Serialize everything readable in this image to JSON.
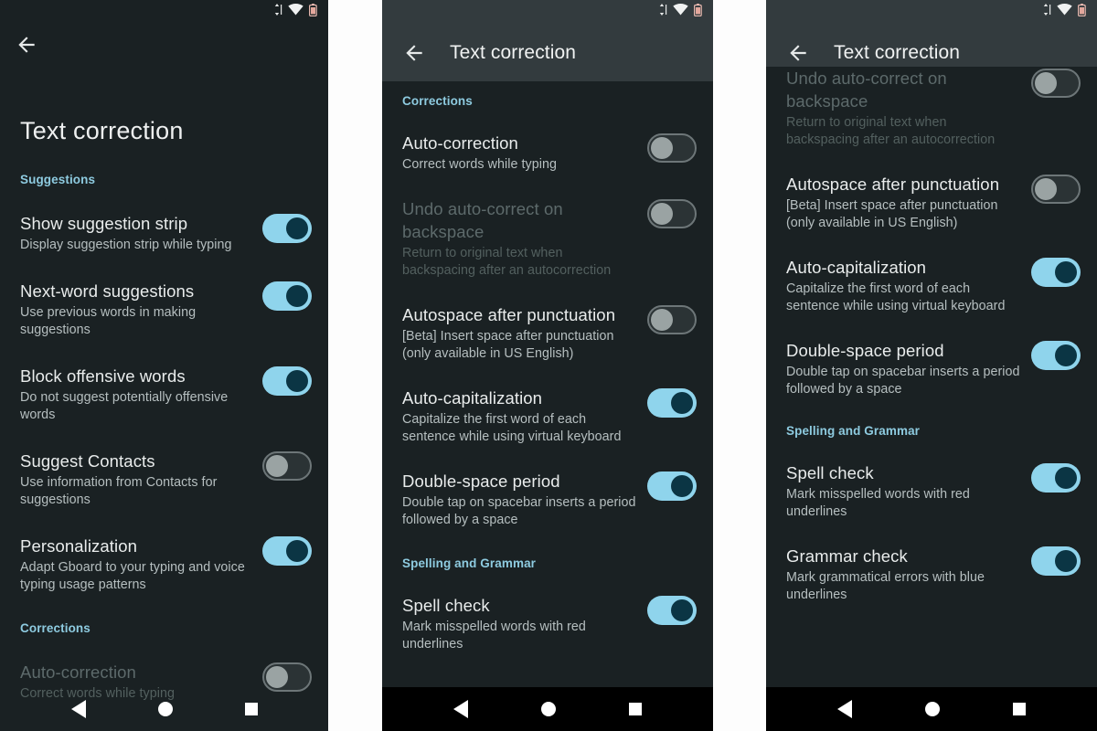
{
  "colors": {
    "background": "#1a2123",
    "appbar": "#333b3e",
    "section_header": "#8ecbe0",
    "toggle_on_track": "#8fd4ec",
    "toggle_on_knob": "#0b3544",
    "toggle_off_track": "#2b3335",
    "toggle_off_knob": "#9aa3a3",
    "title_text": "#e9ecec",
    "sub_text": "#b6bfc0",
    "disabled_text": "#5d6a6b",
    "navbar": "#000000"
  },
  "statusbar": {
    "icons": [
      "data-transfer-arrows-icon",
      "wifi-icon",
      "battery-icon"
    ]
  },
  "navbar": {
    "back_label": "back-triangle",
    "home_label": "home-circle",
    "recents_label": "recents-square"
  },
  "panel1": {
    "back_icon": "back-arrow-icon",
    "page_title": "Text correction",
    "sections": [
      {
        "header": "Suggestions",
        "items": [
          {
            "title": "Show suggestion strip",
            "subtitle": "Display suggestion strip while typing",
            "toggle": "on",
            "disabled": false
          },
          {
            "title": "Next-word suggestions",
            "subtitle": "Use previous words in making suggestions",
            "toggle": "on",
            "disabled": false
          },
          {
            "title": "Block offensive words",
            "subtitle": "Do not suggest potentially offensive words",
            "toggle": "on",
            "disabled": false
          },
          {
            "title": "Suggest Contacts",
            "subtitle": "Use information from Contacts for suggestions",
            "toggle": "off",
            "disabled": false
          },
          {
            "title": "Personalization",
            "subtitle": "Adapt Gboard to your typing and voice typing usage patterns",
            "toggle": "on",
            "disabled": false
          }
        ]
      },
      {
        "header": "Corrections",
        "items": [
          {
            "title": "Auto-correction",
            "subtitle": "Correct words while typing",
            "toggle": "off",
            "disabled": true
          }
        ]
      }
    ]
  },
  "panel2": {
    "back_icon": "back-arrow-icon",
    "appbar_title": "Text correction",
    "sections": [
      {
        "header": "Corrections",
        "items": [
          {
            "title": "Auto-correction",
            "subtitle": "Correct words while typing",
            "toggle": "off",
            "disabled": false
          },
          {
            "title": "Undo auto-correct on backspace",
            "subtitle": "Return to original text when backspacing after an autocorrection",
            "toggle": "off",
            "disabled": true
          },
          {
            "title": "Autospace after punctuation",
            "subtitle": "[Beta] Insert space after punctuation (only available in US English)",
            "toggle": "off",
            "disabled": false
          },
          {
            "title": "Auto-capitalization",
            "subtitle": "Capitalize the first word of each sentence while using virtual keyboard",
            "toggle": "on",
            "disabled": false
          },
          {
            "title": "Double-space period",
            "subtitle": "Double tap on spacebar inserts a period followed by a space",
            "toggle": "on",
            "disabled": false
          }
        ]
      },
      {
        "header": "Spelling and Grammar",
        "items": [
          {
            "title": "Spell check",
            "subtitle": "Mark misspelled words with red underlines",
            "toggle": "on",
            "disabled": false
          }
        ]
      }
    ]
  },
  "panel3": {
    "back_icon": "back-arrow-icon",
    "appbar_title": "Text correction",
    "sections": [
      {
        "header": "",
        "items": [
          {
            "title": "Undo auto-correct on backspace",
            "subtitle": "Return to original text when backspacing after an autocorrection",
            "toggle": "off",
            "disabled": true
          },
          {
            "title": "Autospace after punctuation",
            "subtitle": "[Beta] Insert space after punctuation (only available in US English)",
            "toggle": "off",
            "disabled": false
          },
          {
            "title": "Auto-capitalization",
            "subtitle": "Capitalize the first word of each sentence while using virtual keyboard",
            "toggle": "on",
            "disabled": false
          },
          {
            "title": "Double-space period",
            "subtitle": "Double tap on spacebar inserts a period followed by a space",
            "toggle": "on",
            "disabled": false
          }
        ]
      },
      {
        "header": "Spelling and Grammar",
        "items": [
          {
            "title": "Spell check",
            "subtitle": "Mark misspelled words with red underlines",
            "toggle": "on",
            "disabled": false
          },
          {
            "title": "Grammar check",
            "subtitle": "Mark grammatical errors with blue underlines",
            "toggle": "on",
            "disabled": false
          }
        ]
      }
    ]
  }
}
